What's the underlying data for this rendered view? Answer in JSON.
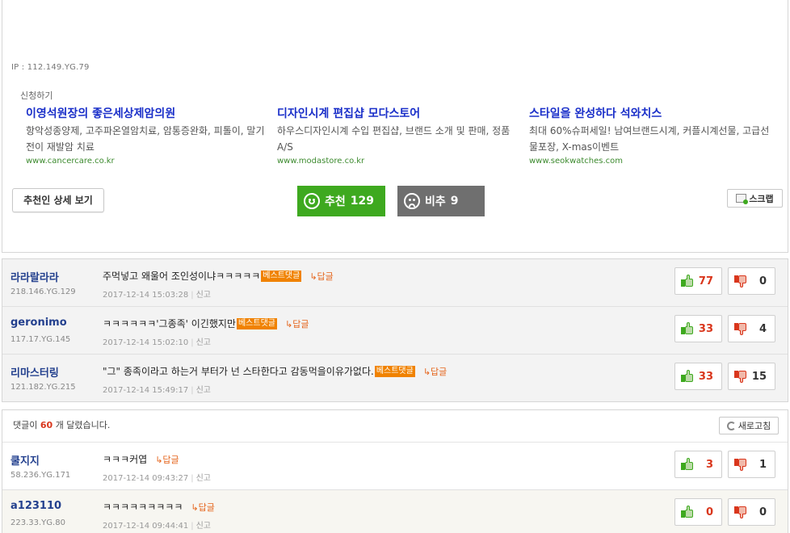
{
  "post": {
    "ip": "IP : 112.149.YG.79",
    "ad_request": "신청하기",
    "ads": [
      {
        "title": "이영석원장의 좋은세상제암의원",
        "desc": "항악성종양제, 고주파온열암치료, 암통증완화, 피톨이, 말기 전이 재발암 치료",
        "url": "www.cancercare.co.kr"
      },
      {
        "title": "디자인시계 편집샵 모다스토어",
        "desc": "하우스디자인시계 수입 편집샵, 브랜드 소개 및 판매, 정품 A/S",
        "url": "www.modastore.co.kr"
      },
      {
        "title": "스타일을 완성하다 석와치스",
        "desc": "최대 60%슈퍼세일! 남여브랜드시계, 커플시계선물, 고급선물포장, X-mas이벤트",
        "url": "www.seokwatches.com"
      }
    ],
    "detail_button": "추천인 상세 보기",
    "recommend_label": "추천",
    "recommend_count": "129",
    "oppose_label": "비추",
    "oppose_count": "9",
    "scrap_button": "스크랩"
  },
  "best_comments": [
    {
      "nick": "라라랄라라",
      "ip": "218.146.YG.129",
      "text": "주먹넣고 왜울어 조인성이냐ㅋㅋㅋㅋㅋ",
      "badge": "베스트댓글",
      "reply": "↳답글",
      "time": "2017-12-14 15:03:28",
      "report": "신고",
      "up": "77",
      "down": "0"
    },
    {
      "nick": "geronimo",
      "ip": "117.17.YG.145",
      "text": "ㅋㅋㅋㅋㅋㅋ'그종족' 이긴했지만",
      "badge": "베스트댓글",
      "reply": "↳답글",
      "time": "2017-12-14 15:02:10",
      "report": "신고",
      "up": "33",
      "down": "4"
    },
    {
      "nick": "리마스터링",
      "ip": "121.182.YG.215",
      "text": "\"그\" 종족이라고 하는거 부터가 넌 스타한다고 감동먹을이유가없다.",
      "badge": "베스트댓글",
      "reply": "↳답글",
      "time": "2017-12-14 15:49:17",
      "report": "신고",
      "up": "33",
      "down": "15"
    }
  ],
  "comments_header": {
    "prefix": "댓글이",
    "count": "60",
    "suffix": "개 달렸습니다.",
    "refresh": "새로고침"
  },
  "comments": [
    {
      "nick": "쿨지지",
      "ip": "58.236.YG.171",
      "text": "ㅋㅋㅋ커엽",
      "reply": "↳답글",
      "time": "2017-12-14 09:43:27",
      "report": "신고",
      "up": "3",
      "down": "1"
    },
    {
      "nick": "a123110",
      "ip": "223.33.YG.80",
      "text": "ㅋㅋㅋㅋㅋㅋㅋㅋㅋ",
      "reply": "↳답글",
      "time": "2017-12-14 09:44:41",
      "report": "신고",
      "up": "0",
      "down": "0"
    }
  ],
  "colors": {
    "recommend": "#3ea91f",
    "oppose": "#6f6f6f",
    "best_badge": "#f08200",
    "nick": "#23408e",
    "ad_title": "#1a2fc9",
    "ad_url": "#3c8a2e"
  }
}
